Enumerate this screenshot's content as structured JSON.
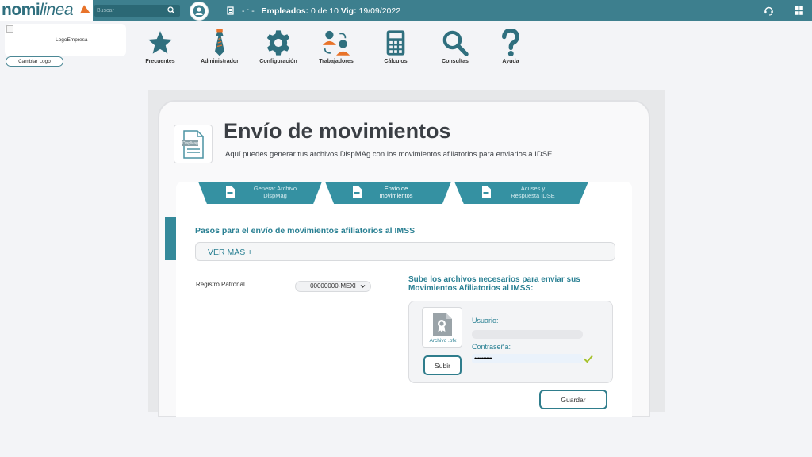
{
  "header": {
    "logo_primary": "nomi",
    "logo_secondary": "linea",
    "search_placeholder": "Buscar",
    "separator": "- : -",
    "employees_label": "Empleados:",
    "employees_value": "0 de 10",
    "validity_label": "Vig:",
    "validity_value": "19/09/2022"
  },
  "company": {
    "logo_alt": "LogoEmpresa",
    "change_logo_label": "Cambiar Logo"
  },
  "nav": {
    "items": [
      {
        "label": "Frecuentes",
        "icon": "star-icon"
      },
      {
        "label": "Administrador",
        "icon": "tie-icon"
      },
      {
        "label": "Configuración",
        "icon": "gear-icon"
      },
      {
        "label": "Trabajadores",
        "icon": "workers-icon"
      },
      {
        "label": "Cálculos",
        "icon": "calculator-icon"
      },
      {
        "label": "Consultas",
        "icon": "search-icon"
      },
      {
        "label": "Ayuda",
        "icon": "question-icon"
      }
    ]
  },
  "page": {
    "title": "Envío de movimientos",
    "subtitle": "Aquí puedes generar tus archivos DispMAg con los movimientos afiliatorios para enviarlos a IDSE",
    "title_icon_text": "DispMag",
    "tabs": [
      {
        "label_line1": "Generar Archivo",
        "label_line2": "DispMag"
      },
      {
        "label_line1": "Envío de",
        "label_line2": "movimientos"
      },
      {
        "label_line1": "Acuses y",
        "label_line2": "Respuesta IDSE"
      }
    ],
    "steps_title": "Pasos para el envío de movimientos afiliatorios al IMSS",
    "see_more": "VER MÁS +",
    "registro_label": "Registro Patronal",
    "registro_value": "00000000-MEXI",
    "upload_title": "Sube los archivos necesarios para enviar sus Movimientos Afiliatorios al IMSS:",
    "cert_label": "Archivo .pfx",
    "upload_button": "Subir",
    "user_label": "Usuario:",
    "user_value": "",
    "password_label": "Contraseña:",
    "password_value": "••••••••••",
    "save_button": "Guardar"
  },
  "colors": {
    "topbar": "#3d7f8e",
    "accent": "#2a8093",
    "tab": "#3591a2",
    "logo_arrow": "#e8732a"
  }
}
